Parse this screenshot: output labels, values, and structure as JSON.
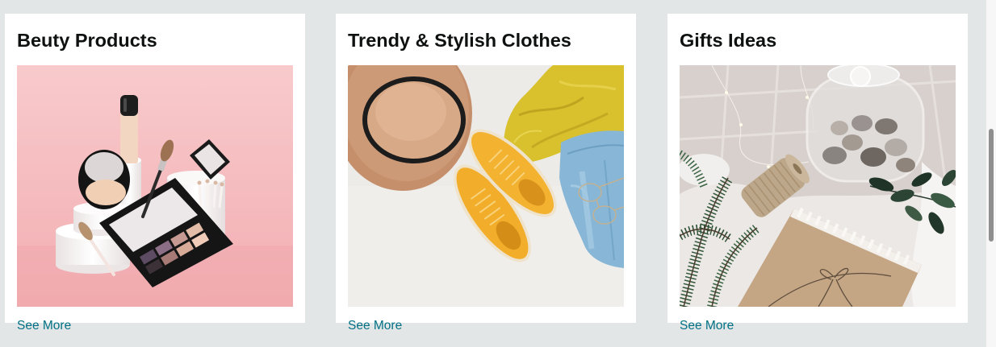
{
  "cards": [
    {
      "title": "Beuty Products",
      "link": "See More"
    },
    {
      "title": "Trendy & Stylish Clothes",
      "link": "See More"
    },
    {
      "title": "Gifts Ideas",
      "link": "See More"
    }
  ],
  "colors": {
    "page_background": "#e3e6e6",
    "card_background": "#ffffff",
    "link": "#007185",
    "title": "#0f1111"
  }
}
